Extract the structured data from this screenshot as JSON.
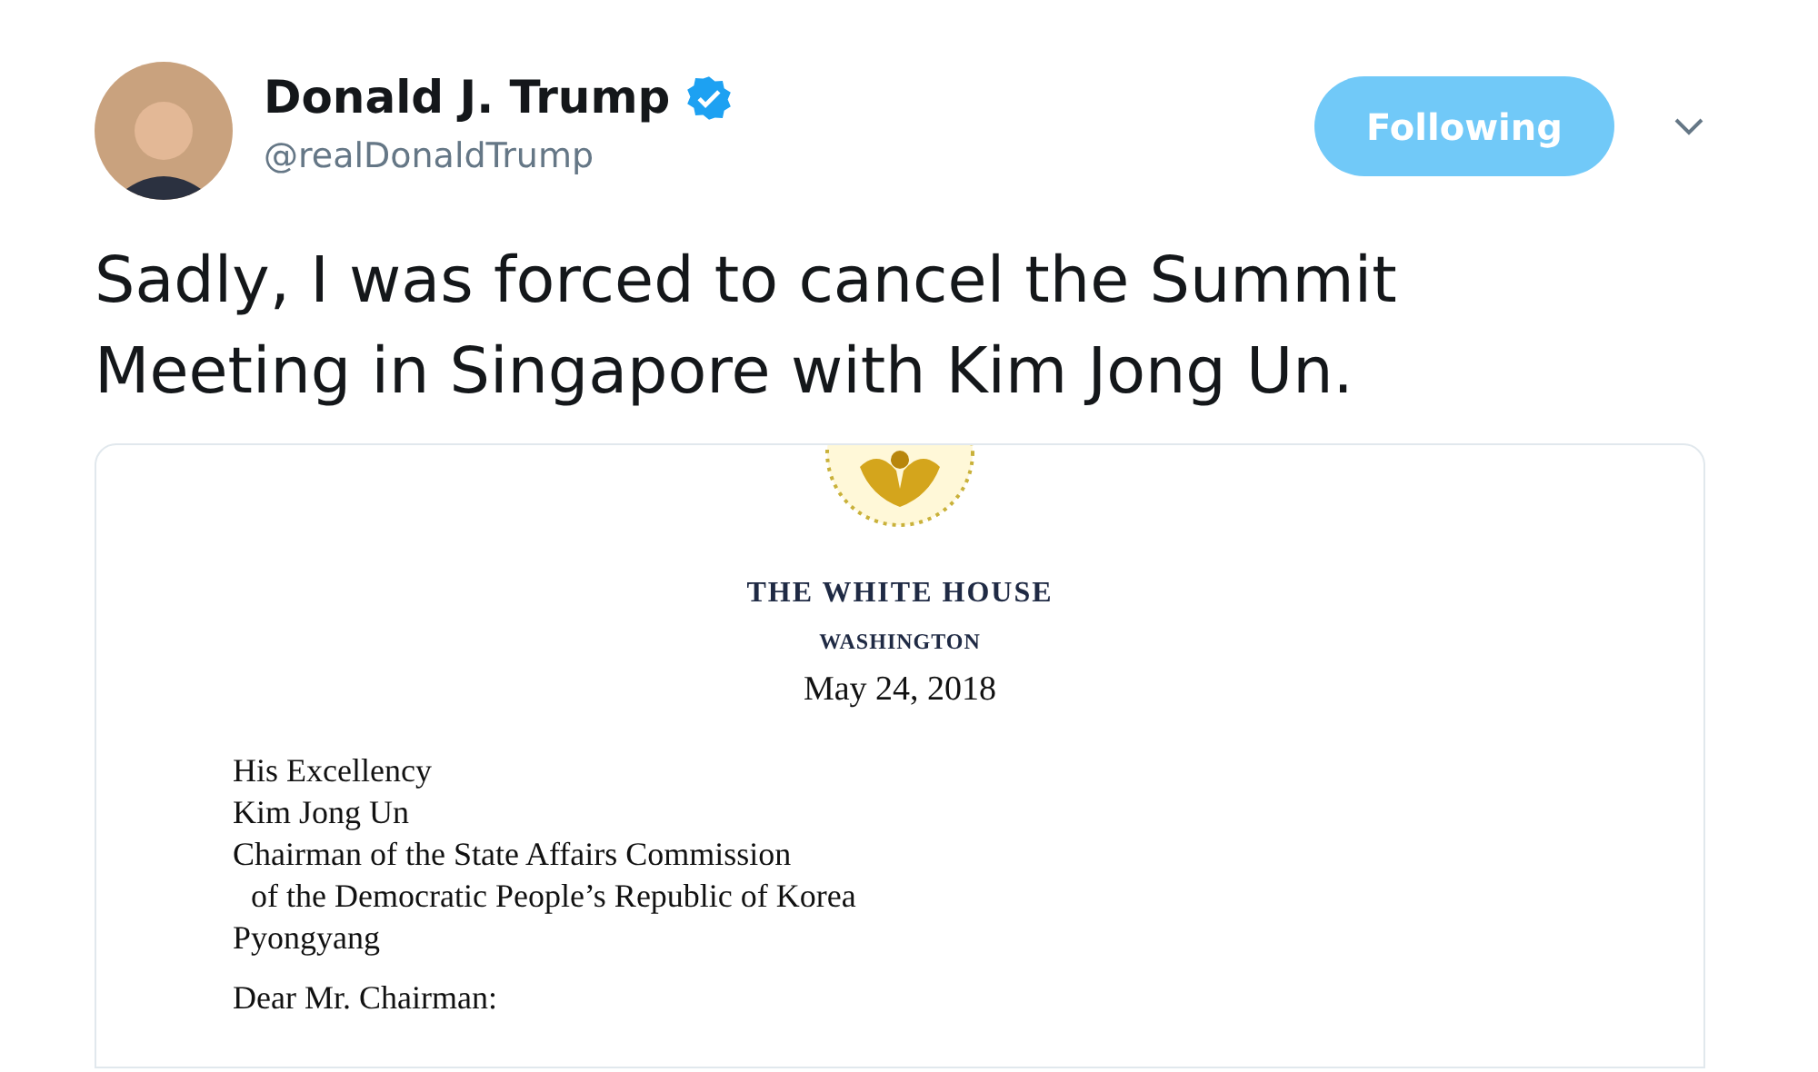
{
  "author": {
    "name": "Donald J. Trump",
    "verified": true,
    "handle": "@realDonaldTrump"
  },
  "follow_button": {
    "label": "Following",
    "selected": true
  },
  "tweet_text": "Sadly, I was forced to cancel the Summit Meeting in Singapore with Kim Jong Un.",
  "letter": {
    "heading": "THE WHITE HOUSE",
    "subheading": "WASHINGTON",
    "date": "May 24, 2018",
    "address": [
      {
        "text": "His Excellency",
        "indent": false
      },
      {
        "text": "Kim Jong Un",
        "indent": false
      },
      {
        "text": "Chairman of the State Affairs Commission",
        "indent": false
      },
      {
        "text": "of the Democratic People’s Republic of Korea",
        "indent": true
      },
      {
        "text": "Pyongyang",
        "indent": false
      }
    ],
    "salutation": "Dear Mr. Chairman:"
  }
}
